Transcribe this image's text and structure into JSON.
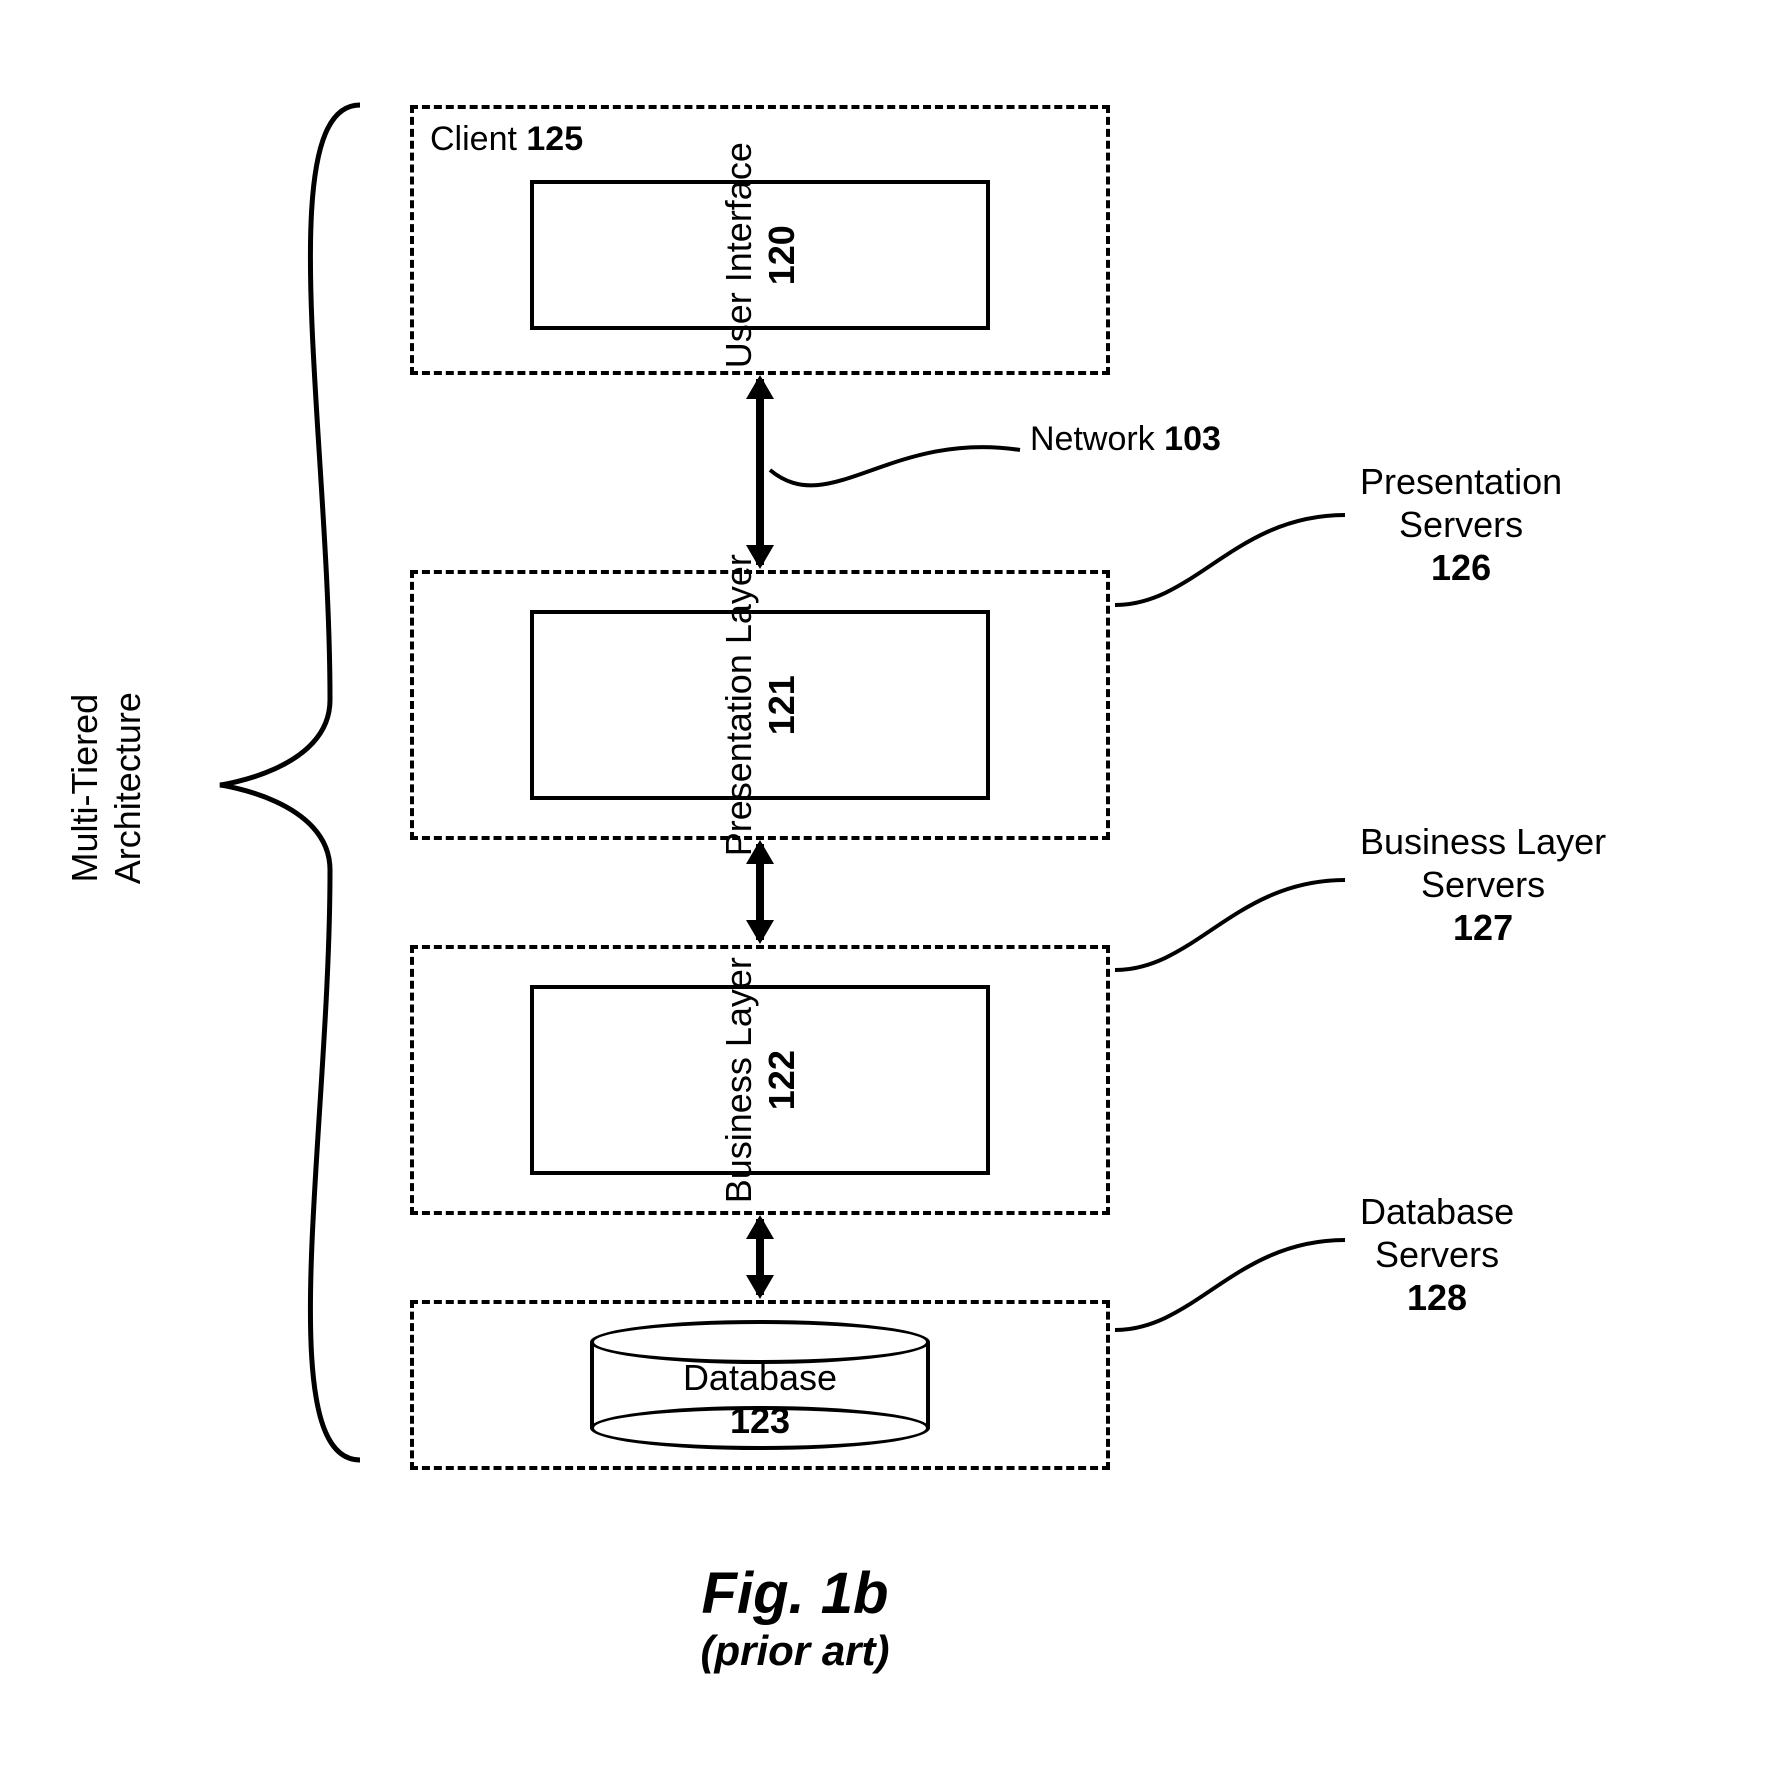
{
  "left_group_label": "Multi-Tiered\nArchitecture",
  "client": {
    "label": "Client",
    "num": "125"
  },
  "tiers": {
    "ui": {
      "label": "User Interface",
      "num": "120"
    },
    "pres": {
      "label": "Presentation Layer",
      "num": "121"
    },
    "biz": {
      "label": "Business Layer",
      "num": "122"
    },
    "db": {
      "label": "Database",
      "num": "123"
    }
  },
  "network": {
    "label": "Network",
    "num": "103"
  },
  "right_labels": {
    "pres": {
      "label": "Presentation\nServers",
      "num": "126"
    },
    "biz": {
      "label": "Business Layer\nServers",
      "num": "127"
    },
    "db": {
      "label": "Database\nServers",
      "num": "128"
    }
  },
  "figure": {
    "title": "Fig. 1b",
    "subtitle": "(prior art)"
  }
}
